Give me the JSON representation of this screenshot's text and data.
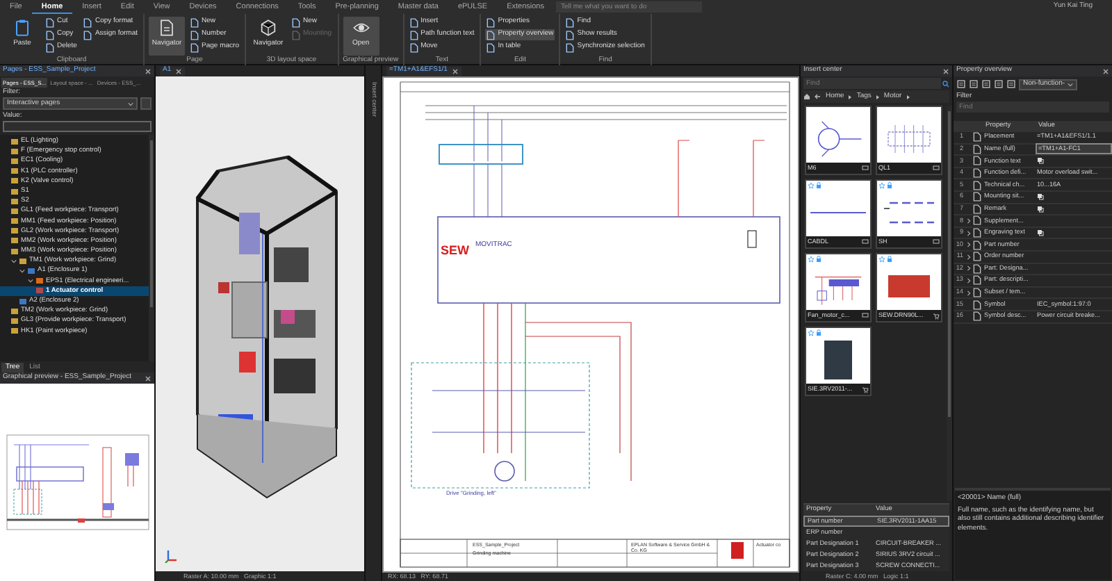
{
  "ribbon": {
    "tabs": [
      {
        "label": "File",
        "selected": false
      },
      {
        "label": "Home",
        "selected": true
      },
      {
        "label": "Insert",
        "selected": false
      },
      {
        "label": "Edit",
        "selected": false
      },
      {
        "label": "View",
        "selected": false
      },
      {
        "label": "Devices",
        "selected": false
      },
      {
        "label": "Connections",
        "selected": false
      },
      {
        "label": "Tools",
        "selected": false
      },
      {
        "label": "Pre-planning",
        "selected": false
      },
      {
        "label": "Master data",
        "selected": false
      },
      {
        "label": "ePULSE",
        "selected": false
      },
      {
        "label": "Extensions",
        "selected": false
      }
    ],
    "search": {
      "placeholder": "Tell me what you want to do"
    },
    "user": "Yun Kai Ting",
    "groups": [
      {
        "label": "Clipboard",
        "items": [
          {
            "label": "Paste",
            "kind": "large",
            "selected": false,
            "disabled": false
          },
          {
            "label": "Cut",
            "kind": "small",
            "selected": false,
            "disabled": false
          },
          {
            "label": "Copy",
            "kind": "small",
            "selected": false,
            "disabled": false
          },
          {
            "label": "Delete",
            "kind": "small",
            "selected": false,
            "disabled": false
          },
          {
            "label": "Copy format",
            "kind": "small",
            "selected": false,
            "disabled": false
          },
          {
            "label": "Assign format",
            "kind": "small",
            "selected": false,
            "disabled": false
          }
        ]
      },
      {
        "label": "Page",
        "items": [
          {
            "label": "Navigator",
            "kind": "large",
            "selected": true,
            "disabled": false
          },
          {
            "label": "New",
            "kind": "small",
            "selected": false,
            "disabled": false
          },
          {
            "label": "Number",
            "kind": "small",
            "selected": false,
            "disabled": false
          },
          {
            "label": "Page macro",
            "kind": "small",
            "selected": false,
            "disabled": false
          }
        ]
      },
      {
        "label": "3D layout space",
        "items": [
          {
            "label": "Navigator",
            "kind": "large",
            "selected": false,
            "disabled": false
          },
          {
            "label": "New",
            "kind": "small",
            "selected": false,
            "disabled": false
          },
          {
            "label": "Mounting",
            "kind": "small",
            "selected": false,
            "disabled": true
          }
        ]
      },
      {
        "label": "Graphical preview",
        "items": [
          {
            "label": "Open",
            "kind": "large",
            "selected": true,
            "disabled": false
          }
        ]
      },
      {
        "label": "Text",
        "items": [
          {
            "label": "Insert",
            "kind": "small",
            "selected": false,
            "disabled": false
          },
          {
            "label": "Path function text",
            "kind": "small",
            "selected": false,
            "disabled": false
          },
          {
            "label": "Move",
            "kind": "small",
            "selected": false,
            "disabled": false
          }
        ]
      },
      {
        "label": "Edit",
        "items": [
          {
            "label": "Properties",
            "kind": "small",
            "selected": false,
            "disabled": false
          },
          {
            "label": "Property overview",
            "kind": "small",
            "selected": true,
            "disabled": false
          },
          {
            "label": "In table",
            "kind": "small",
            "selected": false,
            "disabled": false
          }
        ]
      },
      {
        "label": "Find",
        "items": [
          {
            "label": "Find",
            "kind": "small",
            "selected": false,
            "disabled": false
          },
          {
            "label": "Show results",
            "kind": "small",
            "selected": false,
            "disabled": false
          },
          {
            "label": "Synchronize selection",
            "kind": "small",
            "selected": false,
            "disabled": false
          }
        ]
      }
    ]
  },
  "pages_panel": {
    "title": "Pages - ESS_Sample_Project",
    "tabs": [
      {
        "label": "Pages - ESS_S...",
        "selected": true
      },
      {
        "label": "Layout space - ...",
        "selected": false
      },
      {
        "label": "Devices - ESS_...",
        "selected": false
      }
    ],
    "filter_label": "Filter:",
    "filter_value": "Interactive pages",
    "value_label": "Value:",
    "tree": [
      {
        "label": "EL (Lighting)",
        "kind": "folder",
        "selected": false
      },
      {
        "label": "F (Emergency stop control)",
        "kind": "folder",
        "selected": false
      },
      {
        "label": "EC1 (Cooling)",
        "kind": "folder",
        "selected": false
      },
      {
        "label": "K1 (PLC controller)",
        "kind": "folder",
        "selected": false
      },
      {
        "label": "K2 (Valve control)",
        "kind": "folder",
        "selected": false
      },
      {
        "label": "S1",
        "kind": "folder",
        "selected": false
      },
      {
        "label": "S2",
        "kind": "folder",
        "selected": false
      },
      {
        "label": "GL1 (Feed workpiece: Transport)",
        "kind": "folder",
        "selected": false
      },
      {
        "label": "MM1 (Feed workpiece: Position)",
        "kind": "folder",
        "selected": false
      },
      {
        "label": "GL2 (Work workpiece: Transport)",
        "kind": "folder",
        "selected": false
      },
      {
        "label": "MM2 (Work workpiece: Position)",
        "kind": "folder",
        "selected": false
      },
      {
        "label": "MM3 (Work workpiece: Position)",
        "kind": "folder",
        "selected": false
      },
      {
        "label": "TM1 (Work workpiece: Grind)",
        "kind": "folder",
        "selected": false,
        "expanded": true,
        "children": [
          {
            "label": "A1 (Enclosure 1)",
            "kind": "location",
            "selected": false,
            "expanded": true,
            "children": [
              {
                "label": "EPS1 (Electrical engineeri...",
                "kind": "structure",
                "selected": false,
                "expanded": true,
                "children": [
                  {
                    "label": "1 Actuator control",
                    "kind": "page",
                    "selected": true
                  }
                ]
              }
            ]
          },
          {
            "label": "A2 (Enclosure 2)",
            "kind": "location",
            "selected": false
          }
        ]
      },
      {
        "label": "TM2 (Work workpiece: Grind)",
        "kind": "folder",
        "selected": false
      },
      {
        "label": "GL3 (Provide workpiece: Transport)",
        "kind": "folder",
        "selected": false
      },
      {
        "label": "HK1 (Paint workpiece)",
        "kind": "folder",
        "selected": false
      }
    ],
    "bottom_tabs": [
      {
        "label": "Tree",
        "selected": true
      },
      {
        "label": "List",
        "selected": false
      }
    ]
  },
  "preview_panel": {
    "title": "Graphical preview - ESS_Sample_Project"
  },
  "layout_view": {
    "tab": "A1",
    "status": "Raster A: 10.00 mm   Graphic 1:1"
  },
  "side_strip": {
    "label": "Insert center"
  },
  "schematic": {
    "tab": "=TM1+A1&EFS1/1",
    "labels": [
      {
        "text": "SEW",
        "kind": "logo"
      },
      {
        "text": "MOVITRAC",
        "kind": "title"
      },
      {
        "text": "Drive \"Grinding, left\"",
        "kind": "caption"
      },
      {
        "text": "ESS_Sample_Project",
        "kind": "block"
      },
      {
        "text": "Grinding machine",
        "kind": "block"
      },
      {
        "text": "EPLAN Software & Service GmbH & Co. KG",
        "kind": "block"
      },
      {
        "text": "Actuator co",
        "kind": "block"
      }
    ],
    "status": "RX: 68.13   RY: 68.71"
  },
  "insert_center": {
    "title": "Insert center",
    "find": {
      "placeholder": "Find"
    },
    "breadcrumb": [
      "Home",
      "Tags",
      "Motor"
    ],
    "tiles": [
      {
        "label": "M6",
        "kind": "motor-symbol",
        "favorite_marker": false
      },
      {
        "label": "QL1",
        "kind": "switch-symbol",
        "favorite_marker": false
      },
      {
        "label": "CABDL",
        "kind": "line-symbol",
        "favorite_marker": true
      },
      {
        "label": "SH",
        "kind": "shield-symbol",
        "favorite_marker": true
      },
      {
        "label": "Fan_motor_c...",
        "kind": "macro",
        "favorite_marker": true
      },
      {
        "label": "SEW.DRN90L...",
        "kind": "motor-photo",
        "favorite_marker": true
      },
      {
        "label": "SIE.3RV2011-...",
        "kind": "breaker-photo",
        "favorite_marker": true
      }
    ],
    "properties": {
      "columns": [
        "Property",
        "Value"
      ],
      "rows": [
        {
          "property": "Part number",
          "value": "SIE.3RV2011-1AA15",
          "selected": true
        },
        {
          "property": "ERP number",
          "selected": false
        },
        {
          "property": "Part Designation 1",
          "value": "CIRCUIT-BREAKER ...",
          "selected": false
        },
        {
          "property": "Part Designation 2",
          "value": "SIRIUS 3RV2 circuit ...",
          "selected": false
        },
        {
          "property": "Part Designation 3",
          "value": "SCREW CONNECTI...",
          "selected": false
        }
      ]
    },
    "status": "Raster C: 4.00 mm   Logic 1:1"
  },
  "property_overview": {
    "title": "Property overview",
    "dropdown": "Non-function-",
    "filter_label": "Filter",
    "find": {
      "placeholder": "Find"
    },
    "columns": [
      "Property",
      "Value"
    ],
    "rows": [
      {
        "no": "1",
        "property": "Placement",
        "value": "=TM1+A1&EFS1/1.1",
        "expandable": false,
        "value_icon": false,
        "selected": false
      },
      {
        "no": "2",
        "property": "Name (full)",
        "value": "=TM1+A1-FC1",
        "expandable": false,
        "value_icon": false,
        "selected": true
      },
      {
        "no": "3",
        "property": "Function text",
        "expandable": false,
        "value_icon": true,
        "selected": false
      },
      {
        "no": "4",
        "property": "Function defi...",
        "value": "Motor overload swit...",
        "expandable": false,
        "value_icon": false,
        "selected": false
      },
      {
        "no": "5",
        "property": "Technical ch...",
        "value": "10...16A",
        "expandable": false,
        "value_icon": false,
        "selected": false
      },
      {
        "no": "6",
        "property": "Mounting sit...",
        "expandable": false,
        "value_icon": true,
        "selected": false
      },
      {
        "no": "7",
        "property": "Remark",
        "expandable": false,
        "value_icon": true,
        "selected": false
      },
      {
        "no": "8",
        "property": "Supplement...",
        "expandable": true,
        "value_icon": false,
        "selected": false
      },
      {
        "no": "9",
        "property": "Engraving text",
        "expandable": true,
        "value_icon": true,
        "selected": false
      },
      {
        "no": "10",
        "property": "Part number",
        "expandable": true,
        "value_icon": false,
        "selected": false
      },
      {
        "no": "11",
        "property": "Order number",
        "expandable": true,
        "value_icon": false,
        "selected": false
      },
      {
        "no": "12",
        "property": "Part: Designa...",
        "expandable": true,
        "value_icon": false,
        "selected": false
      },
      {
        "no": "13",
        "property": "Part: descripti...",
        "expandable": true,
        "value_icon": false,
        "selected": false
      },
      {
        "no": "14",
        "property": "Subset / tem...",
        "expandable": true,
        "value_icon": false,
        "selected": false
      },
      {
        "no": "15",
        "property": "Symbol",
        "value": "IEC_symbol:1:97:0",
        "expandable": false,
        "value_icon": false,
        "selected": false
      },
      {
        "no": "16",
        "property": "Symbol desc...",
        "value": "Power circuit breake...",
        "expandable": false,
        "value_icon": false,
        "selected": false
      }
    ],
    "description_title": "<20001> Name (full)",
    "description": "Full name, such as the identifying name, but also still contains additional describing identifier elements."
  }
}
